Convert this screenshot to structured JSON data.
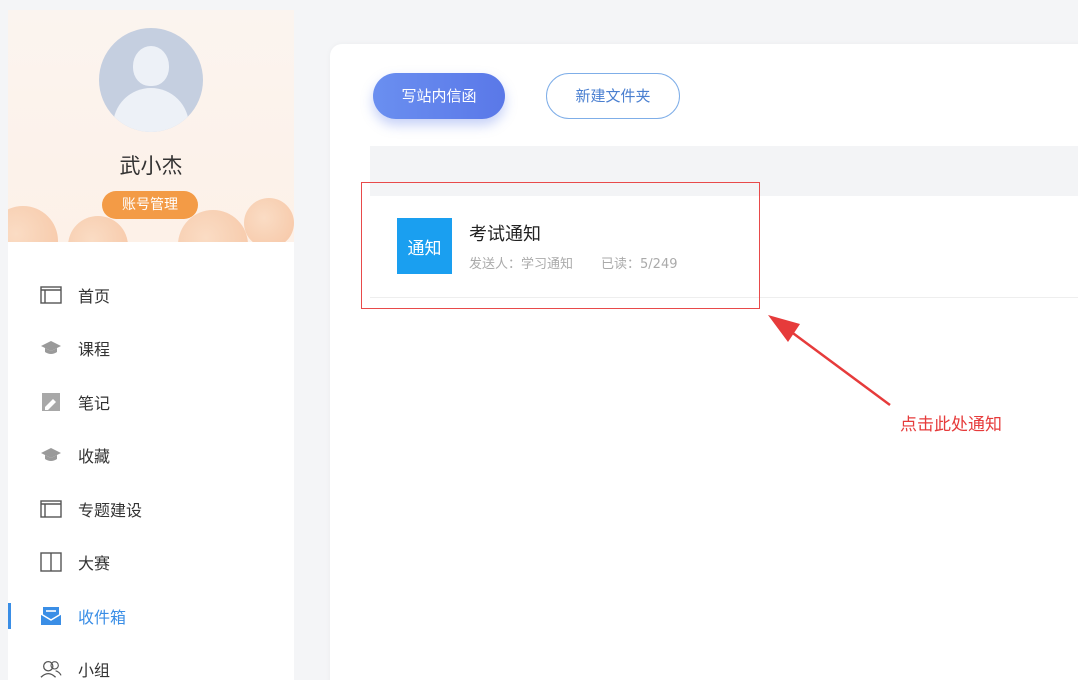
{
  "profile": {
    "name": "武小杰",
    "account_button": "账号管理"
  },
  "nav": {
    "items": [
      {
        "label": "首页",
        "icon": "home-icon"
      },
      {
        "label": "课程",
        "icon": "graduation-cap-icon"
      },
      {
        "label": "笔记",
        "icon": "note-icon"
      },
      {
        "label": "收藏",
        "icon": "collection-icon"
      },
      {
        "label": "专题建设",
        "icon": "topic-icon"
      },
      {
        "label": "大赛",
        "icon": "book-icon"
      },
      {
        "label": "收件箱",
        "icon": "inbox-icon",
        "active": true
      },
      {
        "label": "小组",
        "icon": "group-icon"
      }
    ]
  },
  "toolbar": {
    "write_label": "写站内信函",
    "folder_label": "新建文件夹"
  },
  "message": {
    "badge": "通知",
    "title": "考试通知",
    "sender": "发送人：学习通知",
    "read": "已读：5/249"
  },
  "annotation": {
    "text": "点击此处通知"
  },
  "colors": {
    "accent": "#3a8ee6",
    "badge": "#1a9ff0",
    "account_button": "#f39b46",
    "annotation": "#e63b3b"
  }
}
